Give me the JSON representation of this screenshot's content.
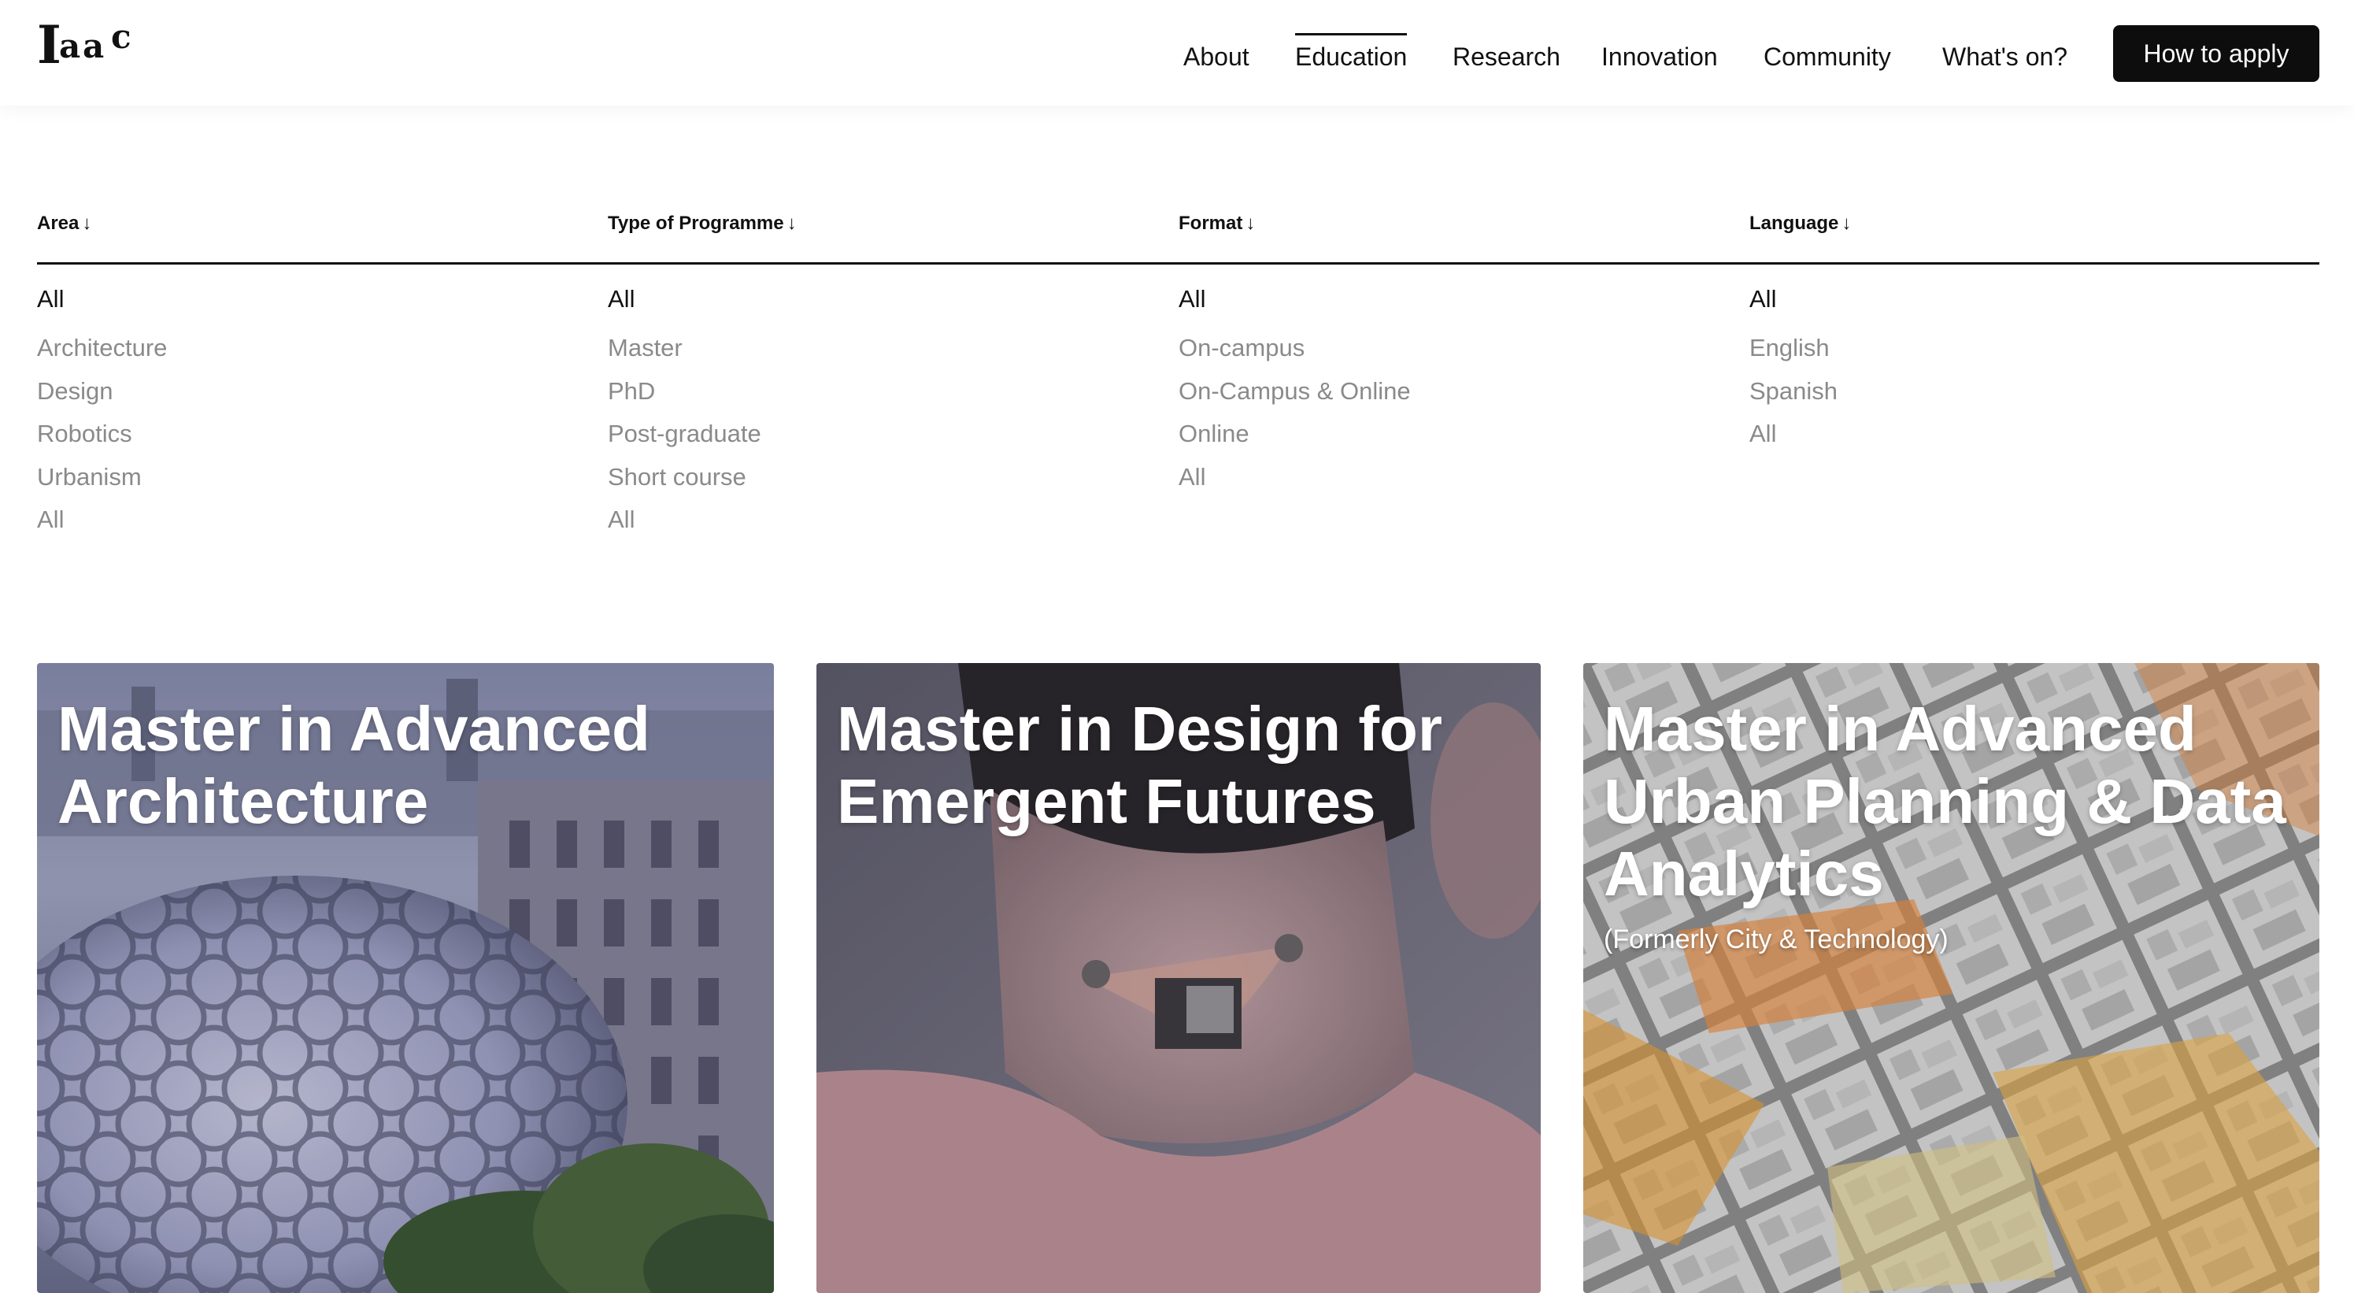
{
  "header": {
    "logo_text": "Iaac",
    "nav": [
      {
        "label": "About",
        "active": false
      },
      {
        "label": "Education",
        "active": true
      },
      {
        "label": "Research",
        "active": false
      },
      {
        "label": "Innovation",
        "active": false
      },
      {
        "label": "Community",
        "active": false
      },
      {
        "label": "What's on?",
        "active": false
      }
    ],
    "apply_label": "How to apply"
  },
  "filters": [
    {
      "heading": "Area",
      "arrow": "↓",
      "options": [
        "All",
        "Architecture",
        "Design",
        "Robotics",
        "Urbanism",
        "All"
      ],
      "selected": 0
    },
    {
      "heading": "Type of Programme",
      "arrow": "↓",
      "options": [
        "All",
        "Master",
        "PhD",
        "Post-graduate",
        "Short course",
        "All"
      ],
      "selected": 0
    },
    {
      "heading": "Format",
      "arrow": "↓",
      "options": [
        "All",
        "On-campus",
        "On-Campus & Online",
        "Online",
        "All"
      ],
      "selected": 0
    },
    {
      "heading": "Language",
      "arrow": "↓",
      "options": [
        "All",
        "English",
        "Spanish",
        "All"
      ],
      "selected": 0
    }
  ],
  "programmes": [
    {
      "title": "Master in Advanced Architecture",
      "subtitle": ""
    },
    {
      "title": "Master in Design for Emergent Futures",
      "subtitle": ""
    },
    {
      "title": "Master in Advanced Urban Planning & Data Analytics",
      "subtitle": "(Formerly City & Technology)"
    }
  ],
  "colors": {
    "text": "#111111",
    "muted_option": "#8a8a8a",
    "button_bg": "#0d0d0d",
    "button_text": "#ffffff",
    "card_overlay": "rgba(30,30,40,0.35)"
  }
}
